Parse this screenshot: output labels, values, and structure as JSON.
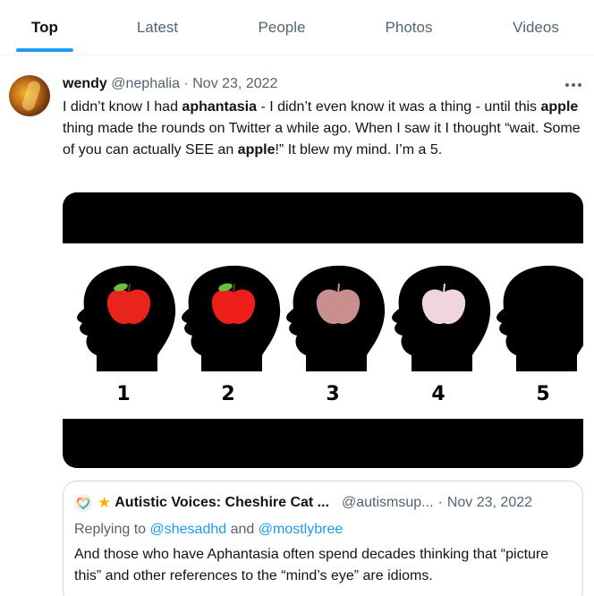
{
  "tabs": [
    {
      "label": "Top",
      "active": true
    },
    {
      "label": "Latest",
      "active": false
    },
    {
      "label": "People",
      "active": false
    },
    {
      "label": "Photos",
      "active": false
    },
    {
      "label": "Videos",
      "active": false
    }
  ],
  "tweet": {
    "display_name": "wendy",
    "handle": "@nephalia",
    "separator": "·",
    "date": "Nov 23, 2022",
    "text_parts": [
      {
        "text": "I didn’t know I had ",
        "bold": false
      },
      {
        "text": "aphantasia",
        "bold": true
      },
      {
        "text": " - I didn’t even know it was a thing - until this ",
        "bold": false
      },
      {
        "text": "apple",
        "bold": true
      },
      {
        "text": " thing made the rounds on Twitter a while ago. When I saw it I thought “wait. Some of you can actually SEE an ",
        "bold": false
      },
      {
        "text": "apple",
        "bold": true
      },
      {
        "text": "!” It blew my mind. I’m a 5.",
        "bold": false
      }
    ],
    "image": {
      "scale_labels": [
        "1",
        "2",
        "3",
        "4",
        "5"
      ],
      "apple_colors": [
        "#e8241c",
        "#ee1f1a",
        "#c98e8e",
        "#f0d6dc",
        ""
      ]
    }
  },
  "quote": {
    "display_name": "Autistic Voices: Cheshire Cat ...",
    "handle": "@autismsup...",
    "separator": "·",
    "date": "Nov 23, 2022",
    "reply_prefix": "Replying to",
    "reply_user1": "@shesadhd",
    "reply_and": "and",
    "reply_user2": "@mostlybree",
    "text": "And those who have Aphantasia often spend decades thinking that “picture this” and other references to the “mind’s eye” are idioms."
  },
  "colors": {
    "accent": "#1d9bf0",
    "muted": "#536471",
    "text": "#0f1419",
    "border": "#cfd9de"
  },
  "icons": [
    "more-icon",
    "rainbow-heart-icon",
    "star-icon"
  ]
}
